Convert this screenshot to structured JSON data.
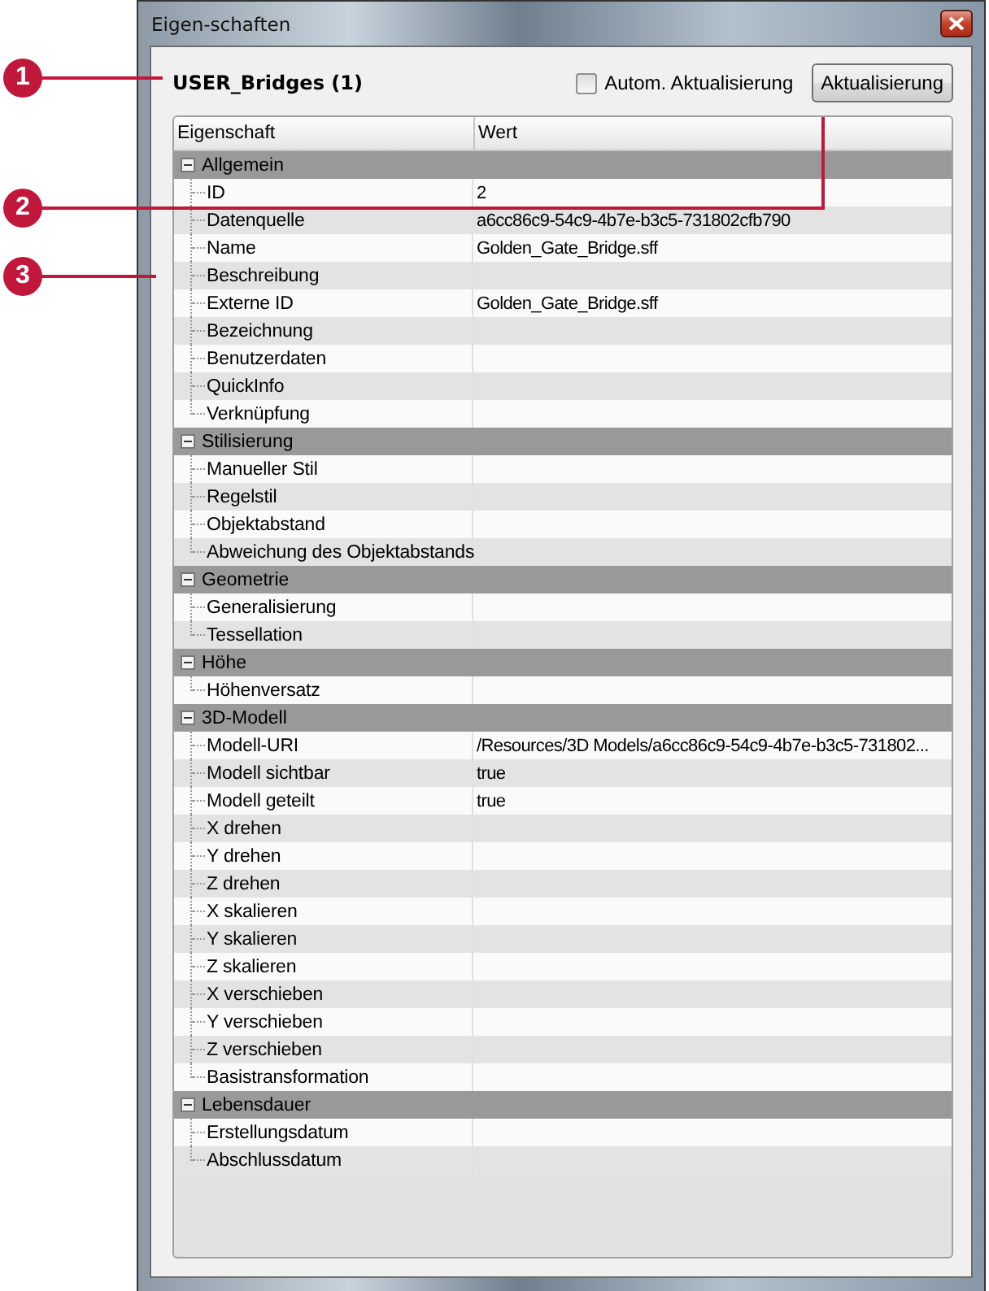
{
  "window": {
    "title": "Eigen-schaften"
  },
  "header": {
    "layer_name": "USER_Bridges (1)",
    "auto_update": {
      "label": "Autom. Aktualisierung",
      "checked": false
    },
    "update_button": "Aktualisierung"
  },
  "table": {
    "columns": [
      "Eigenschaft",
      "Wert"
    ],
    "groups": [
      {
        "name": "Allgemein",
        "expanded": true,
        "rows": [
          {
            "name": "ID",
            "value": "2"
          },
          {
            "name": "Datenquelle",
            "value": "a6cc86c9-54c9-4b7e-b3c5-731802cfb790"
          },
          {
            "name": "Name",
            "value": "Golden_Gate_Bridge.sff"
          },
          {
            "name": "Beschreibung"
          },
          {
            "name": "Externe ID",
            "value": "Golden_Gate_Bridge.sff"
          },
          {
            "name": "Bezeichnung"
          },
          {
            "name": "Benutzerdaten"
          },
          {
            "name": "QuickInfo"
          },
          {
            "name": "Verknüpfung"
          }
        ]
      },
      {
        "name": "Stilisierung",
        "expanded": true,
        "rows": [
          {
            "name": "Manueller Stil"
          },
          {
            "name": "Regelstil"
          },
          {
            "name": "Objektabstand"
          },
          {
            "name": "Abweichung des Objektabstands"
          }
        ]
      },
      {
        "name": "Geometrie",
        "expanded": true,
        "rows": [
          {
            "name": "Generalisierung"
          },
          {
            "name": "Tessellation"
          }
        ]
      },
      {
        "name": "Höhe",
        "expanded": true,
        "rows": [
          {
            "name": "Höhenversatz"
          }
        ]
      },
      {
        "name": "3D-Modell",
        "expanded": true,
        "rows": [
          {
            "name": "Modell-URI",
            "value": "/Resources/3D Models/a6cc86c9-54c9-4b7e-b3c5-731802..."
          },
          {
            "name": "Modell sichtbar",
            "value": "true"
          },
          {
            "name": "Modell geteilt",
            "value": "true"
          },
          {
            "name": "X drehen"
          },
          {
            "name": "Y drehen"
          },
          {
            "name": "Z drehen"
          },
          {
            "name": "X skalieren"
          },
          {
            "name": "Y skalieren"
          },
          {
            "name": "Z skalieren"
          },
          {
            "name": "X verschieben"
          },
          {
            "name": "Y verschieben"
          },
          {
            "name": "Z verschieben"
          },
          {
            "name": "Basistransformation"
          }
        ]
      },
      {
        "name": "Lebensdauer",
        "expanded": true,
        "rows": [
          {
            "name": "Erstellungsdatum"
          },
          {
            "name": "Abschlussdatum"
          }
        ]
      }
    ]
  },
  "callouts": [
    {
      "number": "1"
    },
    {
      "number": "2"
    },
    {
      "number": "3"
    }
  ]
}
